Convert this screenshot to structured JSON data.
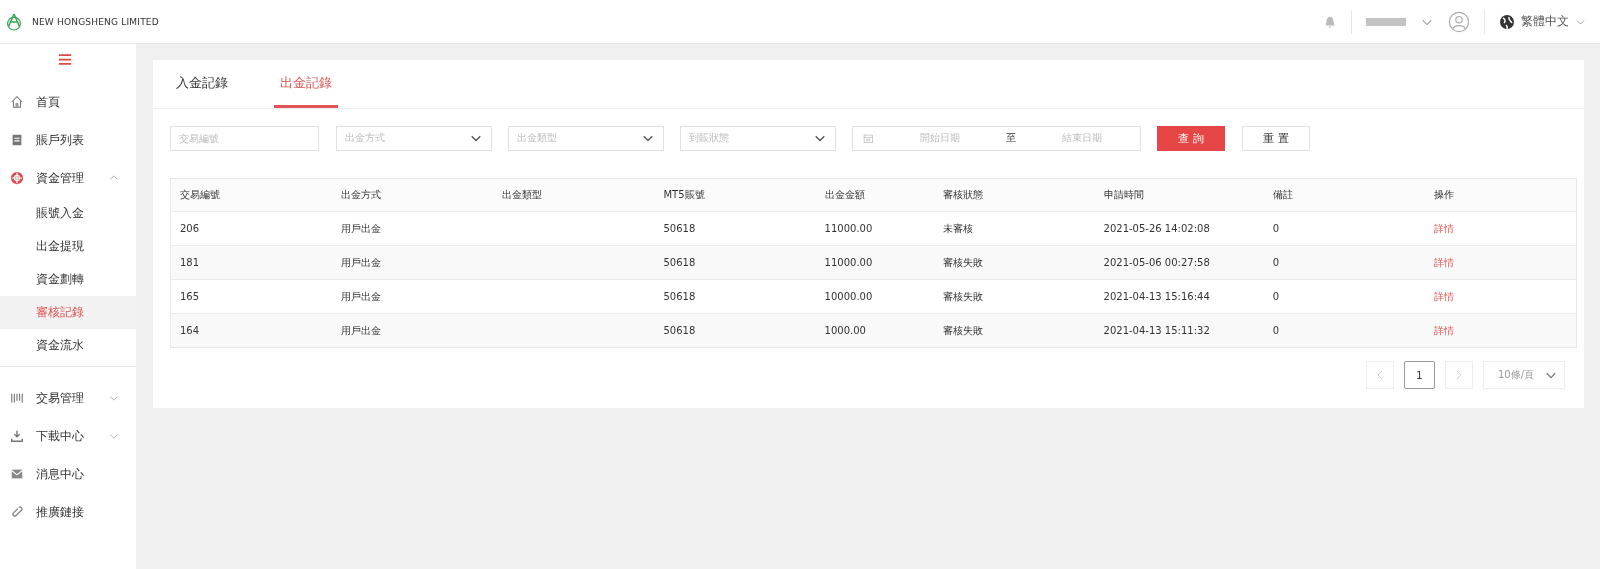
{
  "header": {
    "company": "NEW HONGSHENG LIMITED",
    "language": "繁體中文"
  },
  "sidebar": {
    "items": [
      {
        "kind": "home",
        "label": "首頁"
      },
      {
        "kind": "list",
        "label": "賬戶列表"
      },
      {
        "kind": "funds",
        "label": "資金管理",
        "expanded": true,
        "children": [
          {
            "label": "賬號入金",
            "selected": false
          },
          {
            "label": "出金提現",
            "selected": false
          },
          {
            "label": "資金劃轉",
            "selected": false
          },
          {
            "label": "審核記錄",
            "selected": true
          },
          {
            "label": "資金流水",
            "selected": false
          }
        ]
      },
      {
        "kind": "trade",
        "label": "交易管理",
        "expanded": false
      },
      {
        "kind": "download",
        "label": "下載中心",
        "expanded": false
      },
      {
        "kind": "mail",
        "label": "消息中心"
      },
      {
        "kind": "link",
        "label": "推廣鏈接"
      }
    ]
  },
  "tabs": [
    {
      "label": "入金記錄",
      "selected": false
    },
    {
      "label": "出金記錄",
      "selected": true
    }
  ],
  "filters": {
    "id_placeholder": "交易編號",
    "selects": [
      {
        "placeholder": "出金方式"
      },
      {
        "placeholder": "出金類型"
      },
      {
        "placeholder": "到賬狀態"
      }
    ],
    "start_placeholder": "開始日期",
    "separator": "至",
    "end_placeholder": "結束日期",
    "search_button": "查 詢",
    "reset_button": "重 置"
  },
  "table": {
    "columns": [
      "交易編號",
      "出金方式",
      "出金類型",
      "MT5賬號",
      "出金金額",
      "審核狀態",
      "申請時間",
      "備註",
      "操作"
    ],
    "rows": [
      [
        "206",
        "用戶出金",
        "",
        "50618",
        "11000.00",
        "未審核",
        "2021-05-26 14:02:08",
        "0",
        "詳情"
      ],
      [
        "181",
        "用戶出金",
        "",
        "50618",
        "11000.00",
        "審核失敗",
        "2021-05-06 00:27:58",
        "0",
        "詳情"
      ],
      [
        "165",
        "用戶出金",
        "",
        "50618",
        "10000.00",
        "審核失敗",
        "2021-04-13 15:16:44",
        "0",
        "詳情"
      ],
      [
        "164",
        "用戶出金",
        "",
        "50618",
        "1000.00",
        "審核失敗",
        "2021-04-13 15:11:32",
        "0",
        "詳情"
      ]
    ]
  },
  "pagination": {
    "pages": [
      {
        "label": "1",
        "selected": true
      }
    ],
    "page_size": "10條/頁"
  }
}
